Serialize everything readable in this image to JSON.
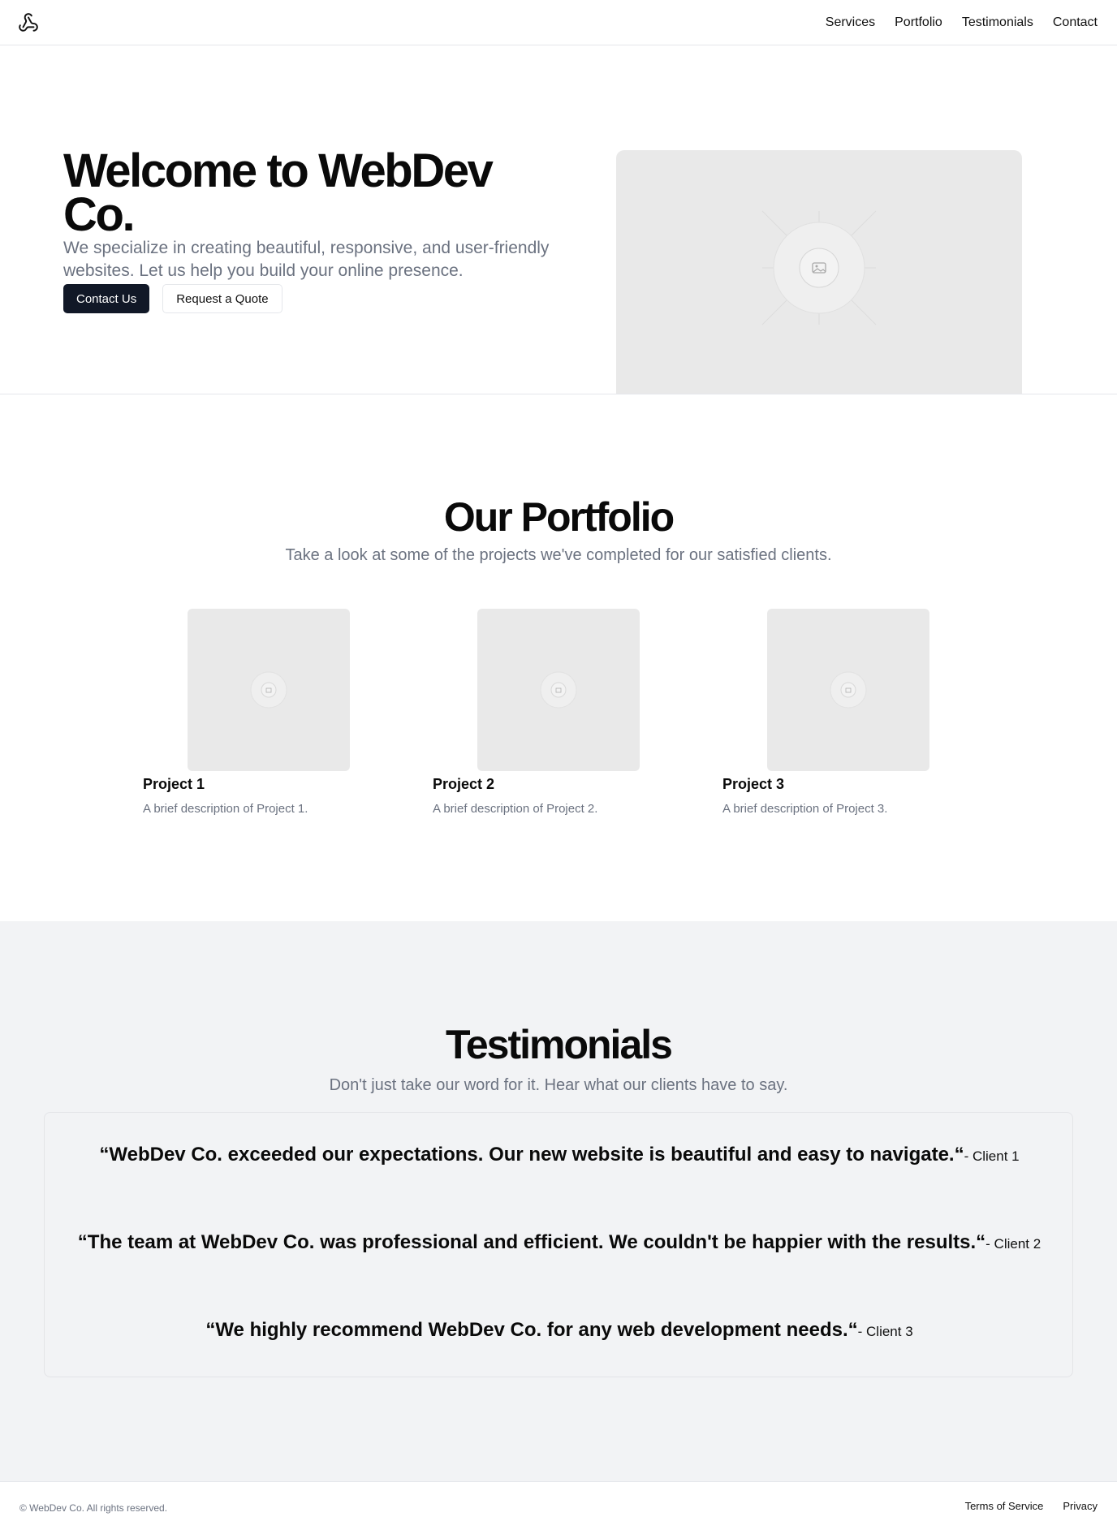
{
  "header": {
    "logo_icon": "webhook-logo-icon",
    "nav": [
      "Services",
      "Portfolio",
      "Testimonials",
      "Contact"
    ]
  },
  "hero": {
    "title": "Welcome to WebDev Co.",
    "subtitle": "We specialize in creating beautiful, responsive, and user-friendly websites. Let us help you build your online presence.",
    "primary_button": "Contact Us",
    "secondary_button": "Request a Quote",
    "image_icon": "image-placeholder-icon"
  },
  "portfolio": {
    "title": "Our Portfolio",
    "subtitle": "Take a look at some of the projects we've completed for our satisfied clients.",
    "projects": [
      {
        "name": "Project 1",
        "description": "A brief description of Project 1."
      },
      {
        "name": "Project 2",
        "description": "A brief description of Project 2."
      },
      {
        "name": "Project 3",
        "description": "A brief description of Project 3."
      }
    ]
  },
  "testimonials": {
    "title": "Testimonials",
    "subtitle": "Don't just take our word for it. Hear what our clients have to say.",
    "items": [
      {
        "quote": "“WebDev Co. exceeded our expectations. Our new website is beautiful and easy to navigate.“",
        "author": "- Client 1"
      },
      {
        "quote": "“The team at WebDev Co. was professional and efficient. We couldn't be happier with the results.“",
        "author": "- Client 2"
      },
      {
        "quote": "“We highly recommend WebDev Co. for any web development needs.“",
        "author": "- Client 3"
      }
    ]
  },
  "footer": {
    "copyright": "© WebDev Co. All rights reserved.",
    "links": [
      "Terms of Service",
      "Privacy"
    ]
  },
  "colors": {
    "primary_button_bg": "#111827",
    "muted_text": "#6b7280",
    "testimonials_bg": "#f2f3f5",
    "placeholder_bg": "#e9e9e9"
  }
}
